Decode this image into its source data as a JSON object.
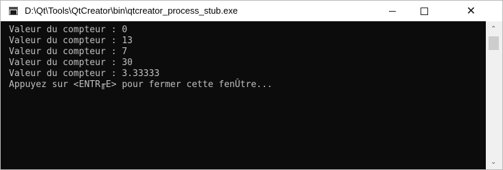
{
  "window": {
    "title": "D:\\Qt\\Tools\\QtCreator\\bin\\qtcreator_process_stub.exe",
    "icon": "console-app-icon",
    "controls": {
      "minimize_icon": "minimize-icon",
      "maximize_icon": "maximize-icon",
      "close_glyph": "✕"
    }
  },
  "console": {
    "background": "#0c0c0c",
    "text_color": "#c0c0c0",
    "lines": [
      "Valeur du compteur : 0",
      "Valeur du compteur : 13",
      "Valeur du compteur : 7",
      "Valeur du compteur : 30",
      "Valeur du compteur : 3.33333",
      "Appuyez sur <ENTR╓E> pour fermer cette fenÛtre..."
    ]
  },
  "scrollbar": {
    "up_glyph": "⌃",
    "down_glyph": "⌄"
  }
}
